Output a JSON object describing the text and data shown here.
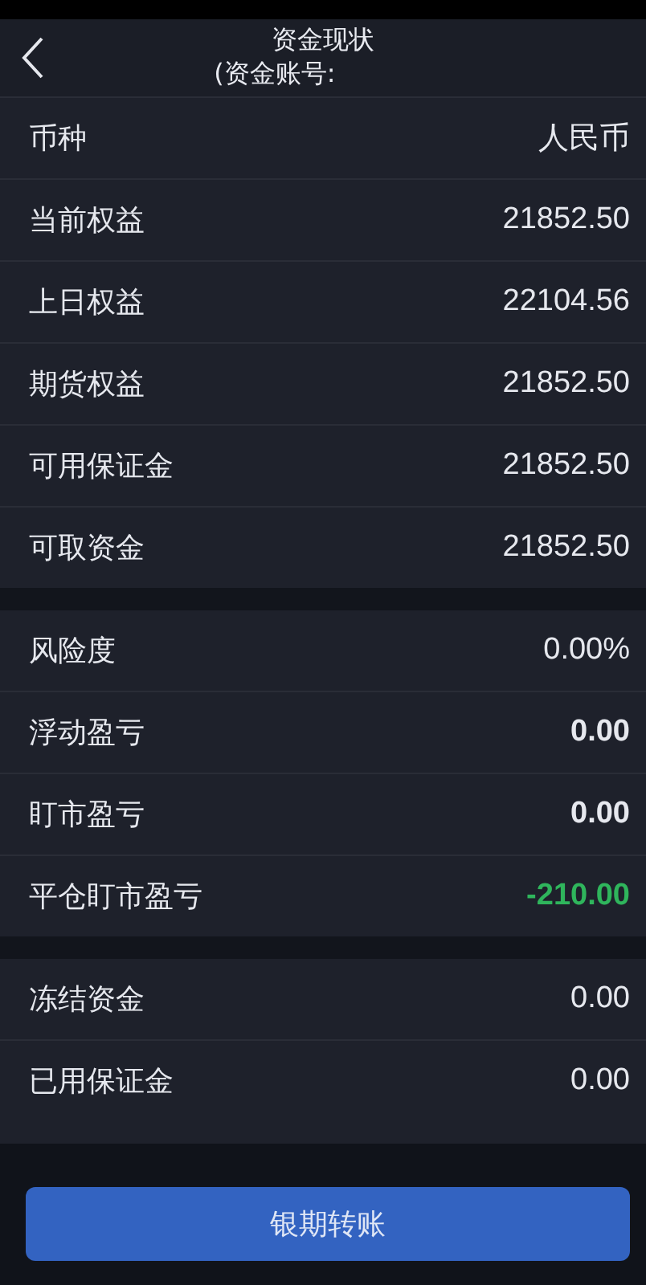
{
  "header": {
    "title": "资金现状",
    "subtitle": "(资金账号:"
  },
  "sections": [
    {
      "rows": [
        {
          "label": "币种",
          "value": "人民币",
          "bold": false,
          "color": "#e6e8ee"
        },
        {
          "label": "当前权益",
          "value": "21852.50",
          "bold": false,
          "color": "#e6e8ee"
        },
        {
          "label": "上日权益",
          "value": "22104.56",
          "bold": false,
          "color": "#e6e8ee"
        },
        {
          "label": "期货权益",
          "value": "21852.50",
          "bold": false,
          "color": "#e6e8ee"
        },
        {
          "label": "可用保证金",
          "value": "21852.50",
          "bold": false,
          "color": "#e6e8ee"
        },
        {
          "label": "可取资金",
          "value": "21852.50",
          "bold": false,
          "color": "#e6e8ee"
        }
      ]
    },
    {
      "rows": [
        {
          "label": "风险度",
          "value": "0.00%",
          "bold": false,
          "color": "#e6e8ee"
        },
        {
          "label": "浮动盈亏",
          "value": "0.00",
          "bold": true,
          "color": "#e6e8ee"
        },
        {
          "label": "盯市盈亏",
          "value": "0.00",
          "bold": true,
          "color": "#e6e8ee"
        },
        {
          "label": "平仓盯市盈亏",
          "value": "-210.00",
          "bold": true,
          "color": "#2fb55c"
        }
      ]
    },
    {
      "rows": [
        {
          "label": "冻结资金",
          "value": "0.00",
          "bold": false,
          "color": "#e6e8ee"
        },
        {
          "label": "已用保证金",
          "value": "0.00",
          "bold": false,
          "color": "#e6e8ee"
        }
      ]
    }
  ],
  "footer": {
    "button": "银期转账"
  }
}
